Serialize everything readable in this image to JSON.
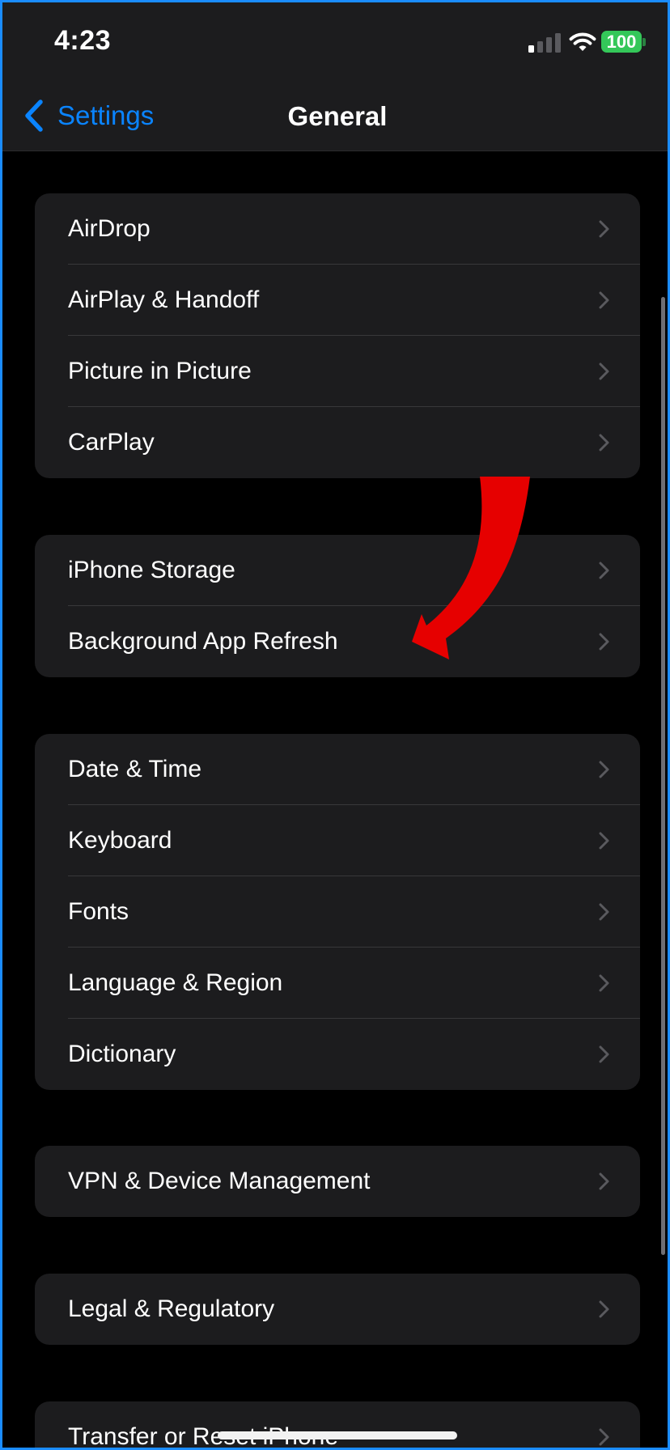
{
  "status_bar": {
    "time": "4:23",
    "battery": "100",
    "signal_icon": "cellular-signal-icon",
    "wifi_icon": "wifi-icon",
    "battery_icon": "battery-icon"
  },
  "nav": {
    "back_label": "Settings",
    "title": "General",
    "back_icon": "chevron-left-icon"
  },
  "groups": [
    {
      "items": [
        {
          "label": "AirDrop"
        },
        {
          "label": "AirPlay & Handoff"
        },
        {
          "label": "Picture in Picture"
        },
        {
          "label": "CarPlay"
        }
      ]
    },
    {
      "items": [
        {
          "label": "iPhone Storage"
        },
        {
          "label": "Background App Refresh"
        }
      ]
    },
    {
      "items": [
        {
          "label": "Date & Time"
        },
        {
          "label": "Keyboard"
        },
        {
          "label": "Fonts"
        },
        {
          "label": "Language & Region"
        },
        {
          "label": "Dictionary"
        }
      ]
    },
    {
      "items": [
        {
          "label": "VPN & Device Management"
        }
      ]
    },
    {
      "items": [
        {
          "label": "Legal & Regulatory"
        }
      ]
    },
    {
      "items": [
        {
          "label": "Transfer or Reset iPhone"
        }
      ]
    }
  ],
  "annotation": {
    "type": "curved-arrow",
    "color": "#e60000",
    "points_to": "Background App Refresh"
  },
  "colors": {
    "accent": "#0a84ff",
    "battery": "#34c759",
    "cell_background": "#1c1c1e",
    "chevron": "#5a5a5e"
  }
}
